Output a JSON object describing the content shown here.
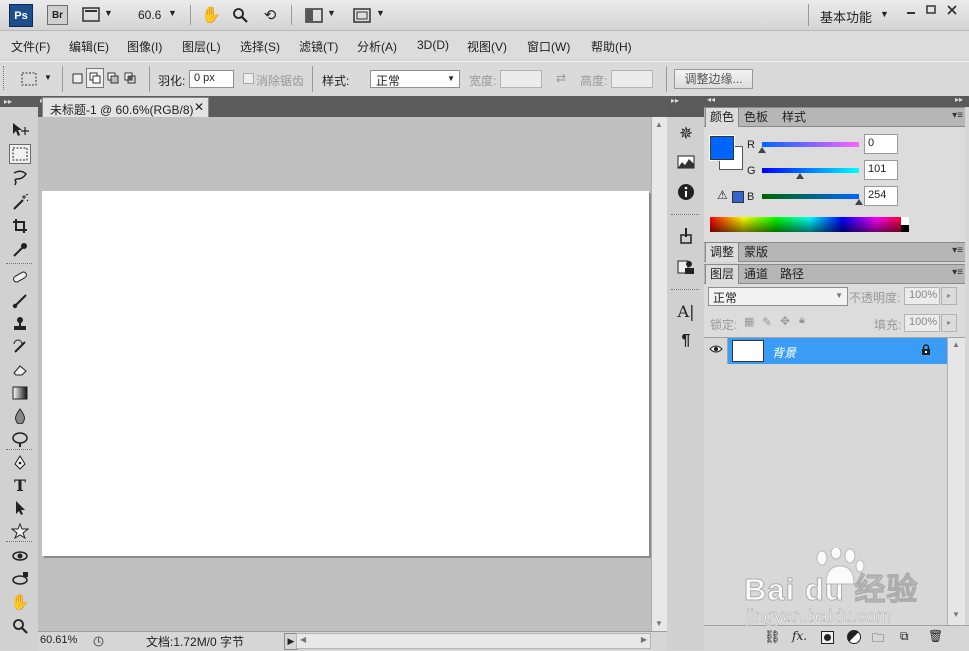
{
  "app": {
    "logo": "Ps",
    "bridge": "Br",
    "zoom": "60.6",
    "workspace": "基本功能"
  },
  "menu": [
    "文件(F)",
    "编辑(E)",
    "图像(I)",
    "图层(L)",
    "选择(S)",
    "滤镜(T)",
    "分析(A)",
    "3D(D)",
    "视图(V)",
    "窗口(W)",
    "帮助(H)"
  ],
  "options": {
    "feather_label": "羽化:",
    "feather_value": "0 px",
    "antialias_label": "消除锯齿",
    "style_label": "样式:",
    "style_value": "正常",
    "width_label": "宽度:",
    "height_label": "高度:",
    "refine_button": "调整边缘..."
  },
  "document": {
    "tab_title": "未标题-1 @ 60.6%(RGB/8)",
    "status_zoom": "60.61%",
    "status_doc": "文档:1.72M/0 字节"
  },
  "color_panel": {
    "tabs": [
      "颜色",
      "色板",
      "样式"
    ],
    "r_label": "R",
    "g_label": "G",
    "b_label": "B",
    "r_value": "0",
    "g_value": "101",
    "b_value": "254",
    "r": 0,
    "g": 101,
    "b": 254,
    "foreground": "#0065fe",
    "background": "#ffffff"
  },
  "adjust_panel": {
    "tabs": [
      "调整",
      "蒙版"
    ]
  },
  "layers_panel": {
    "tabs": [
      "图层",
      "通道",
      "路径"
    ],
    "blend_mode": "正常",
    "opacity_label": "不透明度:",
    "opacity_value": "100%",
    "lock_label": "锁定:",
    "fill_label": "填充:",
    "fill_value": "100%",
    "layers": [
      {
        "name": "背景",
        "selected": true,
        "locked": true
      }
    ]
  },
  "watermark": {
    "brand": "Bai du 经验",
    "url": "jingyan.baidu.com"
  },
  "icons": {
    "tools": [
      "move-icon",
      "rect-marquee-icon",
      "lasso-icon",
      "magic-wand-icon",
      "crop-icon",
      "eyedropper-icon",
      "healing-brush-icon",
      "brush-icon",
      "clone-stamp-icon",
      "history-brush-icon",
      "eraser-icon",
      "gradient-icon",
      "blur-icon",
      "dodge-icon",
      "pen-icon",
      "type-icon",
      "path-select-icon",
      "custom-shape-icon",
      "3d-rotate-icon",
      "3d-orbit-icon",
      "hand-icon",
      "zoom-icon"
    ]
  }
}
